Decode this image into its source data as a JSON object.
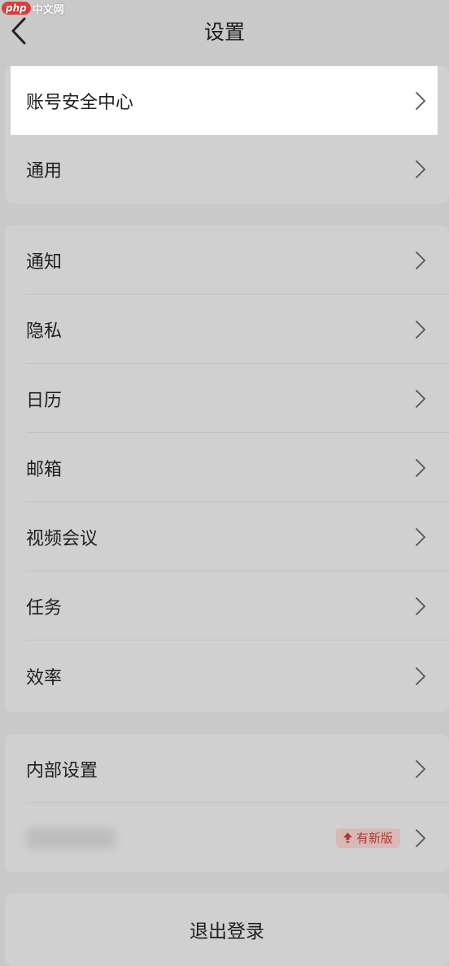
{
  "watermark": {
    "brand": "php",
    "site": "中文网"
  },
  "header": {
    "title": "设置"
  },
  "groups": {
    "account": [
      {
        "label": "账号安全中心"
      },
      {
        "label": "通用"
      }
    ],
    "features": [
      {
        "label": "通知"
      },
      {
        "label": "隐私"
      },
      {
        "label": "日历"
      },
      {
        "label": "邮箱"
      },
      {
        "label": "视频会议"
      },
      {
        "label": "任务"
      },
      {
        "label": "效率"
      }
    ],
    "other": {
      "internal_settings": "内部设置",
      "update_badge": "有新版"
    }
  },
  "logout_label": "退出登录",
  "colors": {
    "background": "#c9c9c9",
    "card": "#d0d0d0",
    "highlight": "#ffffff",
    "badge_bg": "#d9b9b7",
    "badge_text": "#a63b35"
  },
  "icons": [
    "back-arrow-icon",
    "chevron-right-icon",
    "upgrade-arrow-icon"
  ]
}
